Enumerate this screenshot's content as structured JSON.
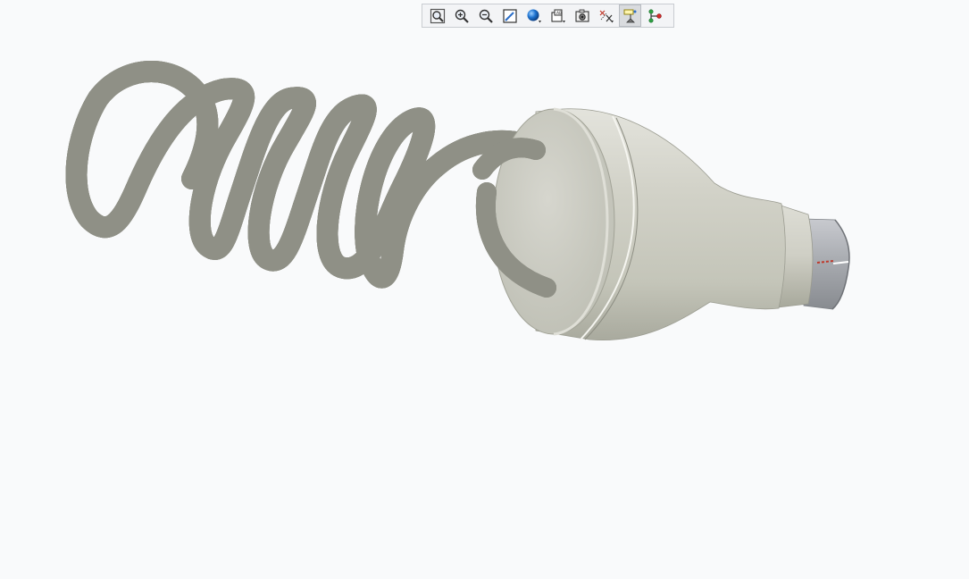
{
  "toolbar": {
    "buttons": [
      {
        "name": "zoom-to-fit",
        "icon": "zoom-fit-icon"
      },
      {
        "name": "zoom-in",
        "icon": "zoom-in-icon"
      },
      {
        "name": "zoom-out",
        "icon": "zoom-out-icon"
      },
      {
        "name": "repaint",
        "icon": "repaint-icon"
      },
      {
        "name": "display-style",
        "icon": "sphere-display-style-icon"
      },
      {
        "name": "saved-views",
        "icon": "saved-views-icon"
      },
      {
        "name": "view-manager",
        "icon": "view-manager-icon"
      },
      {
        "name": "datum-display",
        "icon": "datum-display-icon"
      },
      {
        "name": "annotation-display",
        "icon": "annotation-display-icon",
        "active": true
      },
      {
        "name": "spin-center",
        "icon": "spin-center-icon"
      }
    ]
  },
  "model": {
    "description_icon": "coil-heating-element-model",
    "colors": {
      "body": "#d4d4cb",
      "body_shadow": "#9fa093",
      "metal_sleeve": "#a9acb1",
      "marker_red": "#c0392b",
      "background": "#f9fafb"
    }
  }
}
